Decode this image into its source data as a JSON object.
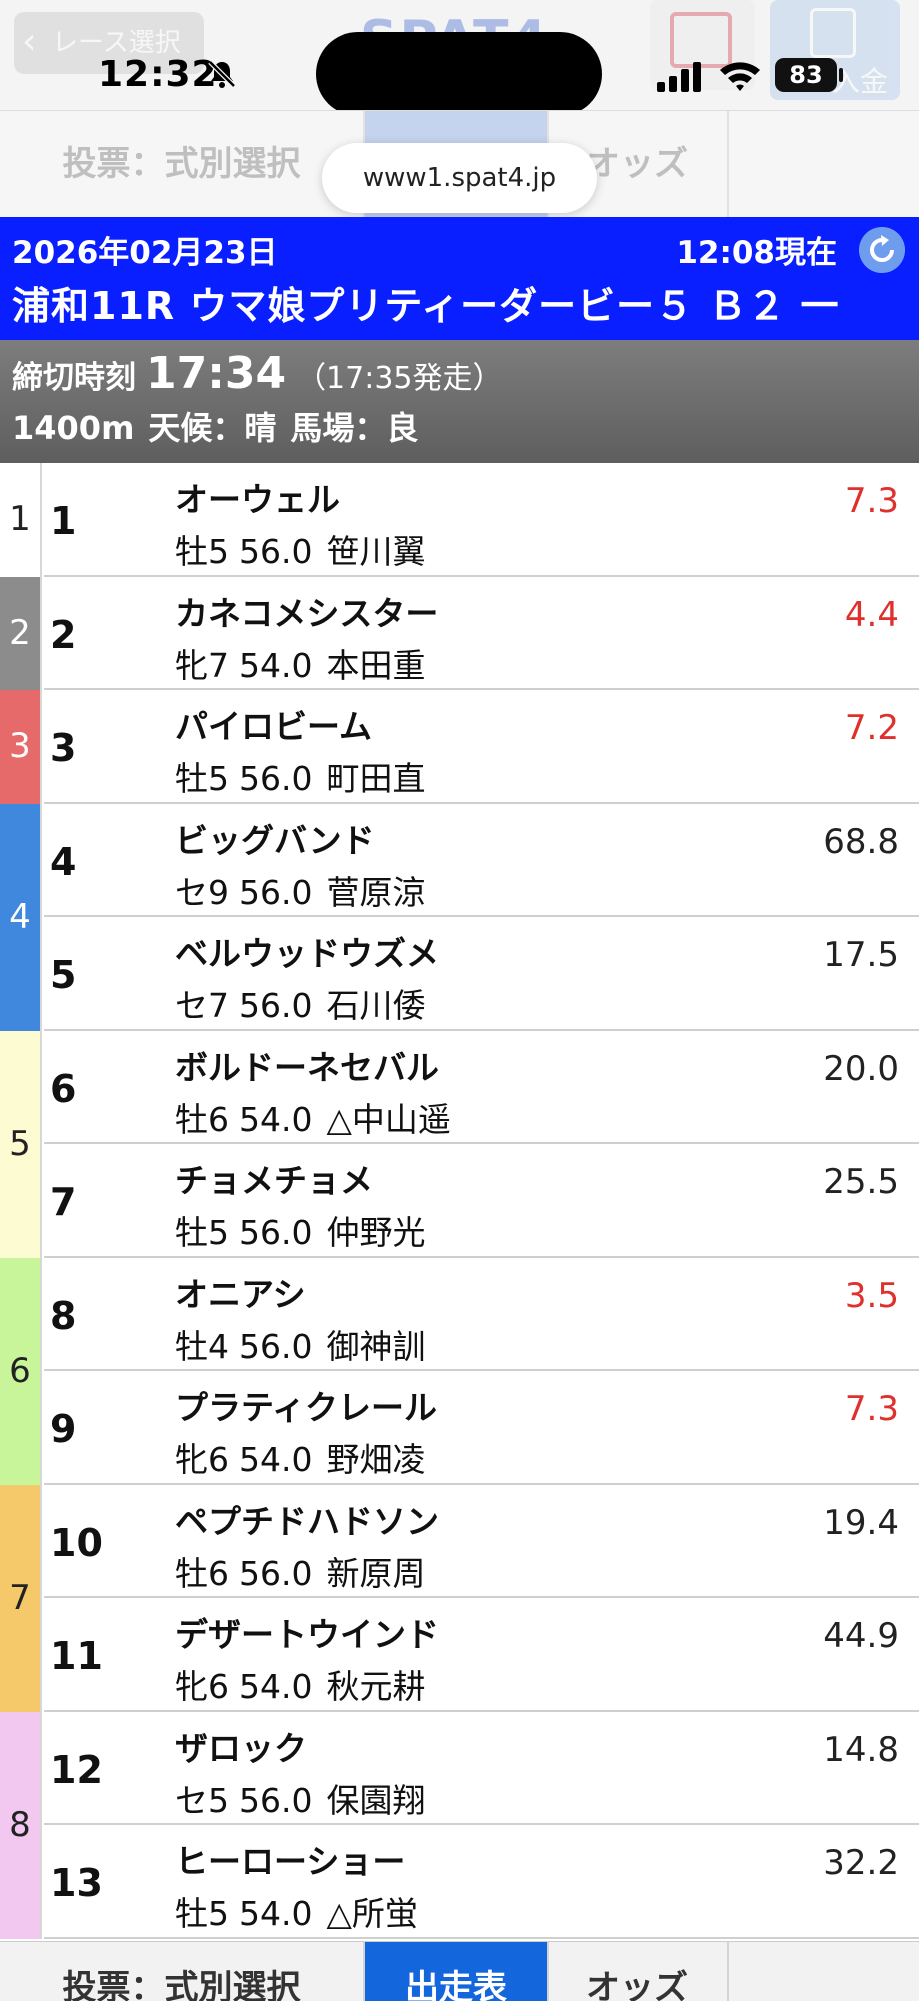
{
  "app_bar": {
    "back_label": "レース選択",
    "logo_text": "SPAT4",
    "deposit_label": "入金"
  },
  "status_bar": {
    "time": "12:32",
    "battery": "83"
  },
  "url": "www1.spat4.jp",
  "tabs": {
    "bet_type": "投票：式別選択",
    "entries": "出走表",
    "odds": "オッズ"
  },
  "race": {
    "date": "2026年02月23日",
    "as_of": "12:08現在",
    "title": "浦和11R ウマ娘プリティーダービー５ Ｂ２ 一",
    "deadline_label": "締切時刻",
    "deadline_time": "17:34",
    "start_time": "（17:35発走）",
    "distance": "1400m",
    "weather": "天候：晴",
    "track": "馬場：良"
  },
  "colors": {
    "header_blue": "#0a1fff",
    "odds_favorite": "#e0302b",
    "tab_active": "#1466dd"
  },
  "waku": [
    {
      "label": "1",
      "bg": "#ffffff",
      "fg": "#222222"
    },
    {
      "label": "2",
      "bg": "#8c8c8c",
      "fg": "#ffffff"
    },
    {
      "label": "3",
      "bg": "#e66a6a",
      "fg": "#ffffff"
    },
    {
      "label": "4",
      "bg": "#3f88dd",
      "fg": "#ffffff"
    },
    {
      "label": "5",
      "bg": "#fdfbd2",
      "fg": "#222222"
    },
    {
      "label": "6",
      "bg": "#c8f59a",
      "fg": "#222222"
    },
    {
      "label": "7",
      "bg": "#f5c86a",
      "fg": "#222222"
    },
    {
      "label": "8",
      "bg": "#f2c8f0",
      "fg": "#222222"
    }
  ],
  "entries": [
    {
      "num": "1",
      "name": "オーウェル",
      "sex_age": "牡5",
      "weight": "56.0",
      "jockey": "笹川翼",
      "odds": "7.3",
      "hot": true
    },
    {
      "num": "2",
      "name": "カネコメシスター",
      "sex_age": "牝7",
      "weight": "54.0",
      "jockey": "本田重",
      "odds": "4.4",
      "hot": true
    },
    {
      "num": "3",
      "name": "パイロビーム",
      "sex_age": "牡5",
      "weight": "56.0",
      "jockey": "町田直",
      "odds": "7.2",
      "hot": true
    },
    {
      "num": "4",
      "name": "ビッグバンド",
      "sex_age": "セ9",
      "weight": "56.0",
      "jockey": "菅原涼",
      "odds": "68.8",
      "hot": false
    },
    {
      "num": "5",
      "name": "ベルウッドウズメ",
      "sex_age": "セ7",
      "weight": "56.0",
      "jockey": "石川倭",
      "odds": "17.5",
      "hot": false
    },
    {
      "num": "6",
      "name": "ボルドーネセバル",
      "sex_age": "牡6",
      "weight": "54.0",
      "jockey": "△中山遥",
      "odds": "20.0",
      "hot": false
    },
    {
      "num": "7",
      "name": "チョメチョメ",
      "sex_age": "牡5",
      "weight": "56.0",
      "jockey": "仲野光",
      "odds": "25.5",
      "hot": false
    },
    {
      "num": "8",
      "name": "オニアシ",
      "sex_age": "牡4",
      "weight": "56.0",
      "jockey": "御神訓",
      "odds": "3.5",
      "hot": true
    },
    {
      "num": "9",
      "name": "プラティクレール",
      "sex_age": "牝6",
      "weight": "54.0",
      "jockey": "野畑凌",
      "odds": "7.3",
      "hot": true
    },
    {
      "num": "10",
      "name": "ペプチドハドソン",
      "sex_age": "牡6",
      "weight": "56.0",
      "jockey": "新原周",
      "odds": "19.4",
      "hot": false
    },
    {
      "num": "11",
      "name": "デザートウインド",
      "sex_age": "牝6",
      "weight": "54.0",
      "jockey": "秋元耕",
      "odds": "44.9",
      "hot": false
    },
    {
      "num": "12",
      "name": "ザロック",
      "sex_age": "セ5",
      "weight": "56.0",
      "jockey": "保園翔",
      "odds": "14.8",
      "hot": false
    },
    {
      "num": "13",
      "name": "ヒーローショー",
      "sex_age": "牡5",
      "weight": "54.0",
      "jockey": "△所蛍",
      "odds": "32.2",
      "hot": false
    }
  ]
}
